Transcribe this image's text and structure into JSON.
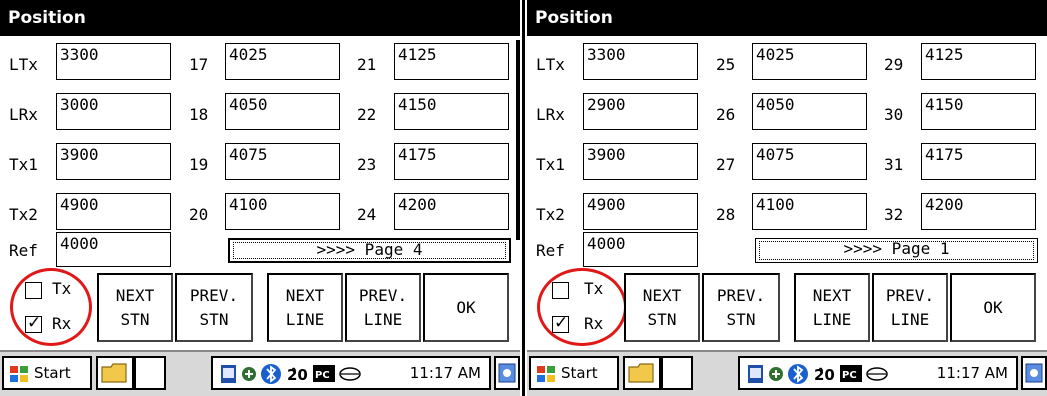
{
  "left": {
    "title": "Position",
    "rows": [
      {
        "label": "LTx",
        "value": "3300",
        "n1": "17",
        "v1": "4025",
        "n2": "21",
        "v2": "4125"
      },
      {
        "label": "LRx",
        "value": "3000",
        "n1": "18",
        "v1": "4050",
        "n2": "22",
        "v2": "4150"
      },
      {
        "label": "Tx1",
        "value": "3900",
        "n1": "19",
        "v1": "4075",
        "n2": "23",
        "v2": "4175"
      },
      {
        "label": "Tx2",
        "value": "4900",
        "n1": "20",
        "v1": "4100",
        "n2": "24",
        "v2": "4200"
      }
    ],
    "ref_label": "Ref",
    "ref_value": "4000",
    "page_button": ">>>> Page 4",
    "tx_label": "Tx",
    "rx_label": "Rx",
    "tx_checked": false,
    "rx_checked": true,
    "buttons": {
      "next_stn": [
        "NEXT",
        "STN"
      ],
      "prev_stn": [
        "PREV.",
        "STN"
      ],
      "next_line": [
        "NEXT",
        "LINE"
      ],
      "prev_line": [
        "PREV.",
        "LINE"
      ],
      "ok": "OK"
    },
    "taskbar": {
      "start": "Start",
      "time": "11:17 AM"
    }
  },
  "right": {
    "title": "Position",
    "rows": [
      {
        "label": "LTx",
        "value": "3300",
        "n1": "25",
        "v1": "4025",
        "n2": "29",
        "v2": "4125"
      },
      {
        "label": "LRx",
        "value": "2900",
        "n1": "26",
        "v1": "4050",
        "n2": "30",
        "v2": "4150"
      },
      {
        "label": "Tx1",
        "value": "3900",
        "n1": "27",
        "v1": "4075",
        "n2": "31",
        "v2": "4175"
      },
      {
        "label": "Tx2",
        "value": "4900",
        "n1": "28",
        "v1": "4100",
        "n2": "32",
        "v2": "4200"
      }
    ],
    "ref_label": "Ref",
    "ref_value": "4000",
    "page_button": ">>>> Page 1",
    "tx_label": "Tx",
    "rx_label": "Rx",
    "tx_checked": false,
    "rx_checked": true,
    "buttons": {
      "next_stn": [
        "NEXT",
        "STN"
      ],
      "prev_stn": [
        "PREV.",
        "STN"
      ],
      "next_line": [
        "NEXT",
        "LINE"
      ],
      "prev_line": [
        "PREV.",
        "LINE"
      ],
      "ok": "OK"
    },
    "taskbar": {
      "start": "Start",
      "time": "11:17 AM"
    }
  },
  "colors": {
    "highlight_oval": "#e01818",
    "title_bg": "#000000",
    "taskbar_bg": "#d8d8d8"
  }
}
